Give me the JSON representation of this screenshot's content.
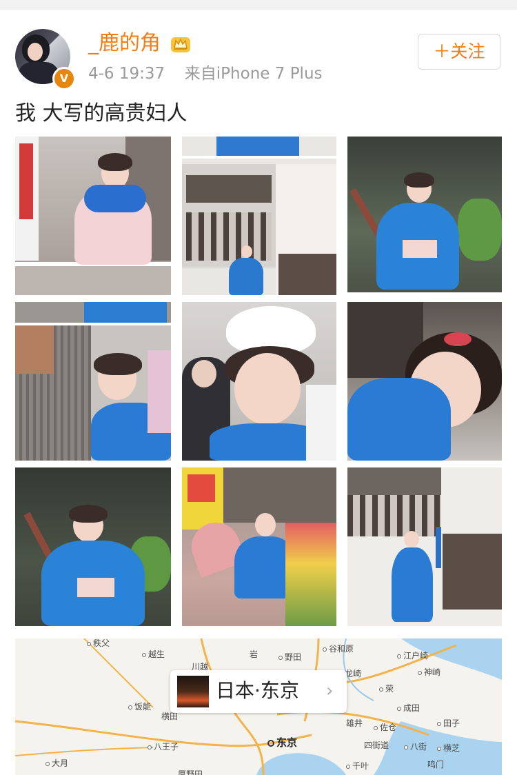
{
  "post": {
    "username": "_鹿的角",
    "timestamp": "4-6 19:37",
    "source": "来自iPhone 7 Plus",
    "follow_label": "＋关注",
    "text": "我 大写的高贵妇人",
    "verified_badge": "V"
  },
  "colors": {
    "accent_orange": "#f07f18",
    "meta_gray": "#9a9a9a",
    "kimono_blue": "#1e78c8"
  },
  "icons": [
    "crown-icon",
    "verified-icon",
    "chevron-right-icon"
  ],
  "location": {
    "label": "日本·东京",
    "chevron": "›"
  },
  "map": {
    "cities": [
      {
        "name": "秩父",
        "dot": true
      },
      {
        "name": "越生",
        "dot": true
      },
      {
        "name": "川越",
        "dot": false
      },
      {
        "name": "岩",
        "dot": false
      },
      {
        "name": "野田",
        "dot": true
      },
      {
        "name": "谷和原",
        "dot": true
      },
      {
        "name": "江户崎",
        "dot": true
      },
      {
        "name": "龙崎",
        "dot": false
      },
      {
        "name": "神崎",
        "dot": true
      },
      {
        "name": "荣",
        "dot": true
      },
      {
        "name": "饭能",
        "dot": true
      },
      {
        "name": "横田",
        "dot": false
      },
      {
        "name": "成田",
        "dot": true
      },
      {
        "name": "雄井",
        "dot": false
      },
      {
        "name": "佐仓",
        "dot": true
      },
      {
        "name": "田子",
        "dot": true
      },
      {
        "name": "八王子",
        "dot": true
      },
      {
        "name": "四街道",
        "dot": false
      },
      {
        "name": "八街",
        "dot": true
      },
      {
        "name": "横芝",
        "dot": true
      },
      {
        "name": "大月",
        "dot": true
      },
      {
        "name": "千叶",
        "dot": true
      },
      {
        "name": "鸣门",
        "dot": false
      },
      {
        "name": "厚野田",
        "dot": false
      }
    ],
    "capital": "东京"
  },
  "photos": [
    {
      "id": "photo-1"
    },
    {
      "id": "photo-2"
    },
    {
      "id": "photo-3"
    },
    {
      "id": "photo-4"
    },
    {
      "id": "photo-5"
    },
    {
      "id": "photo-6"
    },
    {
      "id": "photo-7"
    },
    {
      "id": "photo-8"
    },
    {
      "id": "photo-9"
    }
  ]
}
